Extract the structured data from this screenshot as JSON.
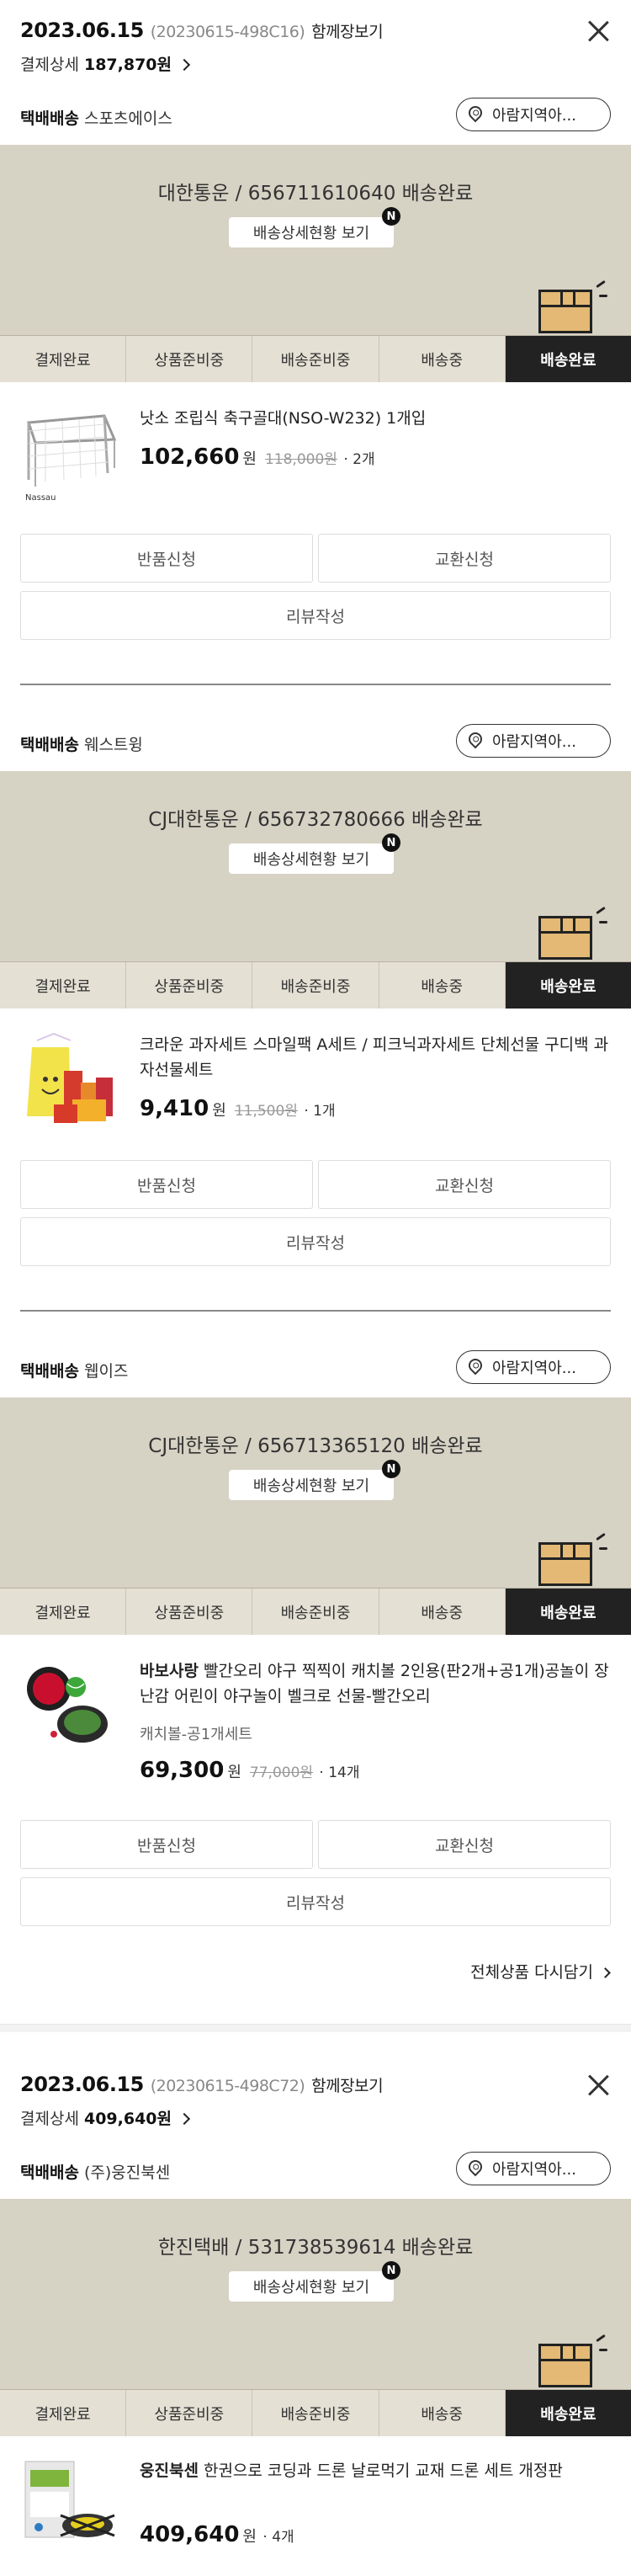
{
  "orders": [
    {
      "date": "2023.06.15",
      "order_no": "(20230615-498C16)",
      "view_together": "함께장보기",
      "payment_label": "결제상세",
      "payment_amount": "187,870원",
      "shipments": [
        {
          "ship_type": "택배배송",
          "seller": "스포츠에이스",
          "region_btn": "아람지역아...",
          "tracking": "대한통운 / 656711610640 배송완료",
          "detail_btn": "배송상세현황 보기",
          "badge": "N",
          "steps": [
            "결제완료",
            "상품준비중",
            "배송준비중",
            "배송중",
            "배송완료"
          ],
          "product": {
            "brand": "",
            "name": "낫소 조립식 축구골대(NSO-W232) 1개입",
            "option": "",
            "price": "102,660",
            "won": "원",
            "orig_price": "118,000원",
            "qty": "· 2개",
            "img_brand": "Nassau"
          },
          "buttons": {
            "return": "반품신청",
            "exchange": "교환신청",
            "review": "리뷰작성"
          }
        },
        {
          "ship_type": "택배배송",
          "seller": "웨스트윙",
          "region_btn": "아람지역아...",
          "tracking": "CJ대한통운 / 656732780666 배송완료",
          "detail_btn": "배송상세현황 보기",
          "badge": "N",
          "steps": [
            "결제완료",
            "상품준비중",
            "배송준비중",
            "배송중",
            "배송완료"
          ],
          "product": {
            "brand": "",
            "name": "크라운 과자세트 스마일팩 A세트 / 피크닉과자세트 단체선물 구디백 과자선물세트",
            "option": "",
            "price": "9,410",
            "won": "원",
            "orig_price": "11,500원",
            "qty": "· 1개"
          },
          "buttons": {
            "return": "반품신청",
            "exchange": "교환신청",
            "review": "리뷰작성"
          }
        },
        {
          "ship_type": "택배배송",
          "seller": "웹이즈",
          "region_btn": "아람지역아...",
          "tracking": "CJ대한통운 / 656713365120 배송완료",
          "detail_btn": "배송상세현황 보기",
          "badge": "N",
          "steps": [
            "결제완료",
            "상품준비중",
            "배송준비중",
            "배송중",
            "배송완료"
          ],
          "product": {
            "brand": "바보사랑",
            "name": "빨간오리 야구 찍찍이 캐치볼 2인용(판2개+공1개)공놀이 장난감 어린이 야구놀이 벨크로 선물-빨간오리",
            "option": "캐치볼-공1개세트",
            "price": "69,300",
            "won": "원",
            "orig_price": "77,000원",
            "qty": "· 14개"
          },
          "buttons": {
            "return": "반품신청",
            "exchange": "교환신청",
            "review": "리뷰작성"
          }
        }
      ],
      "reorder": "전체상품 다시담기"
    },
    {
      "date": "2023.06.15",
      "order_no": "(20230615-498C72)",
      "view_together": "함께장보기",
      "payment_label": "결제상세",
      "payment_amount": "409,640원",
      "shipments": [
        {
          "ship_type": "택배배송",
          "seller": "(주)웅진북센",
          "region_btn": "아람지역아...",
          "tracking": "한진택배 / 531738539614 배송완료",
          "detail_btn": "배송상세현황 보기",
          "badge": "N",
          "steps": [
            "결제완료",
            "상품준비중",
            "배송준비중",
            "배송중",
            "배송완료"
          ],
          "product": {
            "brand": "웅진북센",
            "name": "한권으로 코딩과 드론 날로먹기 교재 드론 세트 개정판",
            "option": "",
            "price": "409,640",
            "won": "원",
            "orig_price": "",
            "qty": "· 4개"
          }
        }
      ]
    }
  ]
}
